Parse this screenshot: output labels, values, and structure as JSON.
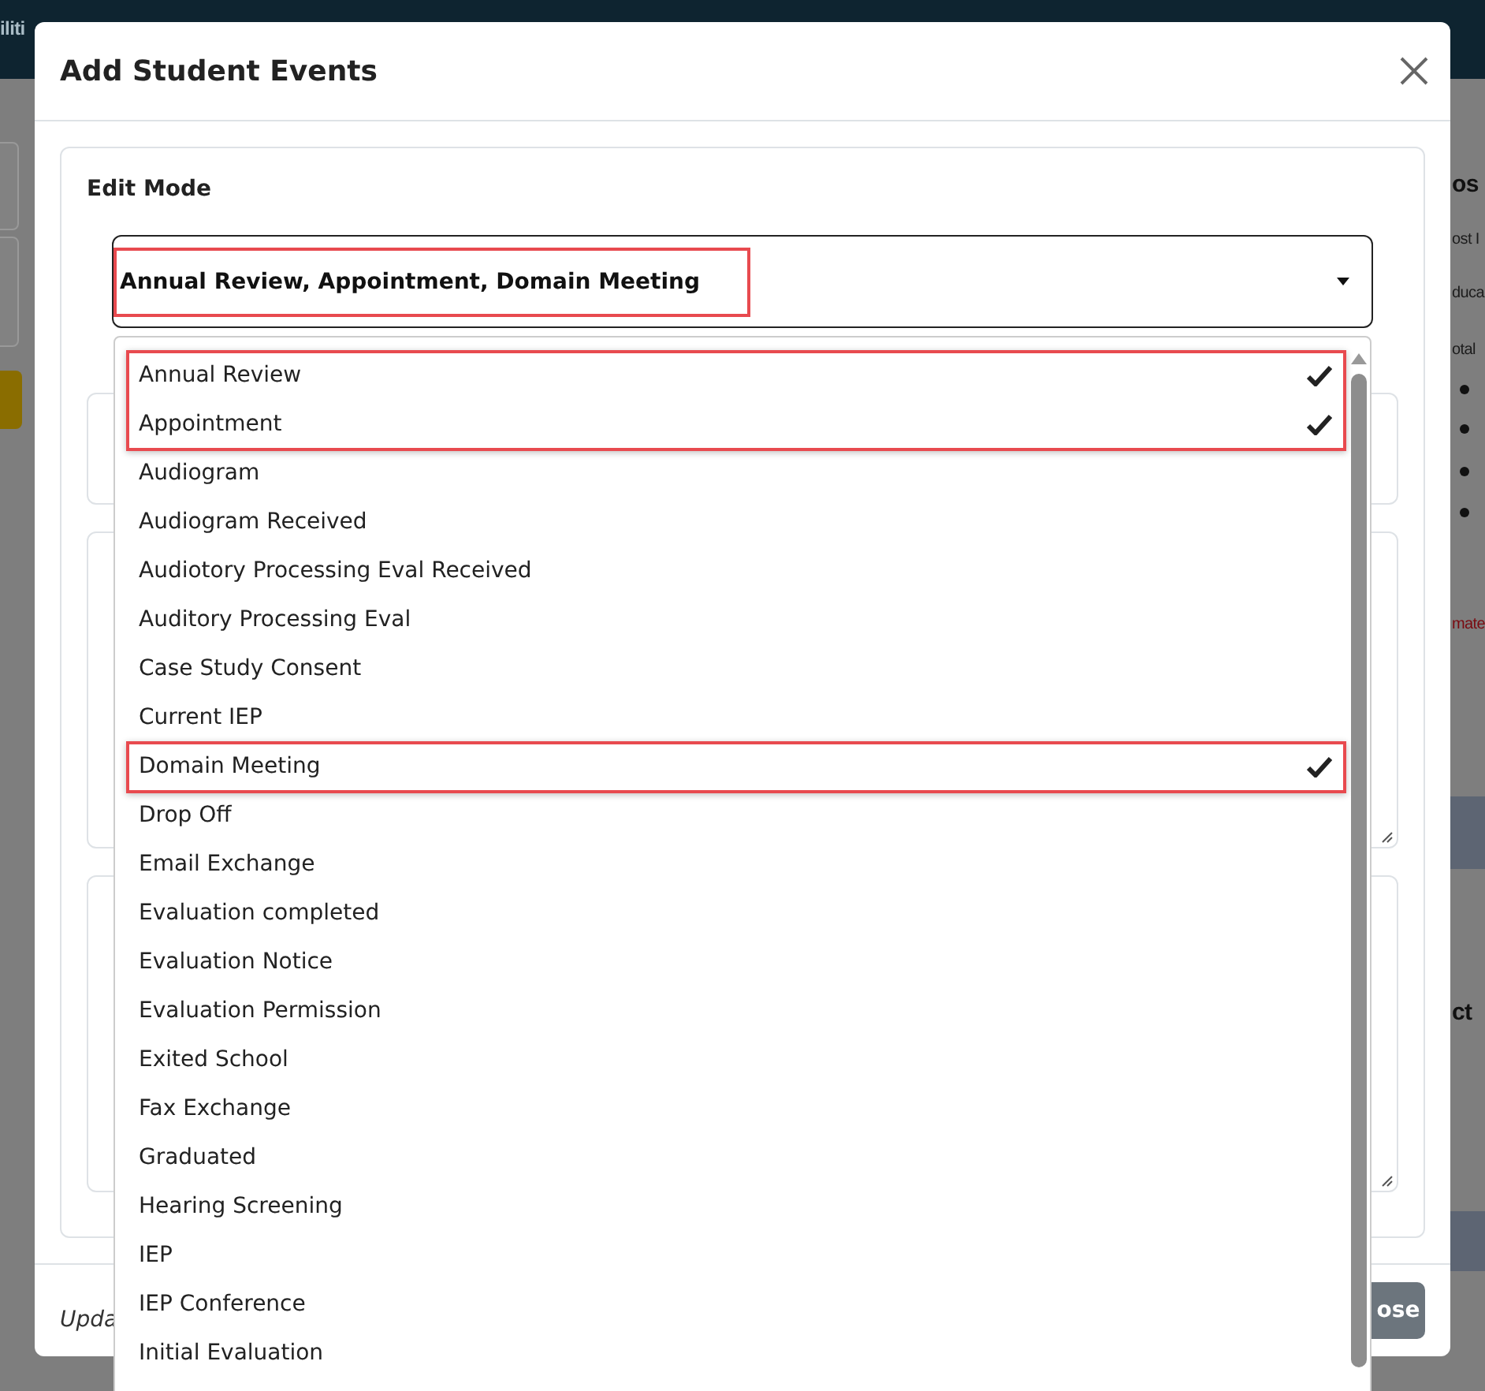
{
  "background_page": {
    "header_fragment": "iliti",
    "right_fragments": [
      {
        "text": "os",
        "kind": "heading"
      },
      {
        "text": "ost I",
        "kind": "plain"
      },
      {
        "text": "duca",
        "kind": "plain"
      },
      {
        "text": "otal",
        "kind": "plain"
      },
      {
        "text": "mate",
        "kind": "alert"
      },
      {
        "text": "ct",
        "kind": "heading"
      }
    ]
  },
  "modal": {
    "title": "Add Student Events",
    "edit_mode": {
      "label": "Edit Mode",
      "select_value": "Annual Review, Appointment, Domain Meeting",
      "fields_behind": [
        {
          "kind": "short"
        },
        {
          "kind": "tall"
        },
        {
          "kind": "tall"
        }
      ]
    },
    "options": [
      {
        "label": "Annual Review",
        "selected": true
      },
      {
        "label": "Appointment",
        "selected": true
      },
      {
        "label": "Audiogram",
        "selected": false
      },
      {
        "label": "Audiogram Received",
        "selected": false
      },
      {
        "label": "Audiotory Processing Eval Received",
        "selected": false
      },
      {
        "label": "Auditory Processing Eval",
        "selected": false
      },
      {
        "label": "Case Study Consent",
        "selected": false
      },
      {
        "label": "Current IEP",
        "selected": false
      },
      {
        "label": "Domain Meeting",
        "selected": true
      },
      {
        "label": "Drop Off",
        "selected": false
      },
      {
        "label": "Email Exchange",
        "selected": false
      },
      {
        "label": "Evaluation completed",
        "selected": false
      },
      {
        "label": "Evaluation Notice",
        "selected": false
      },
      {
        "label": "Evaluation Permission",
        "selected": false
      },
      {
        "label": "Exited School",
        "selected": false
      },
      {
        "label": "Fax Exchange",
        "selected": false
      },
      {
        "label": "Graduated",
        "selected": false
      },
      {
        "label": "Hearing Screening",
        "selected": false
      },
      {
        "label": "IEP",
        "selected": false
      },
      {
        "label": "IEP Conference",
        "selected": false
      },
      {
        "label": "Initial Evaluation",
        "selected": false
      }
    ],
    "footer": {
      "note": "Upda",
      "button": "ose"
    }
  }
}
